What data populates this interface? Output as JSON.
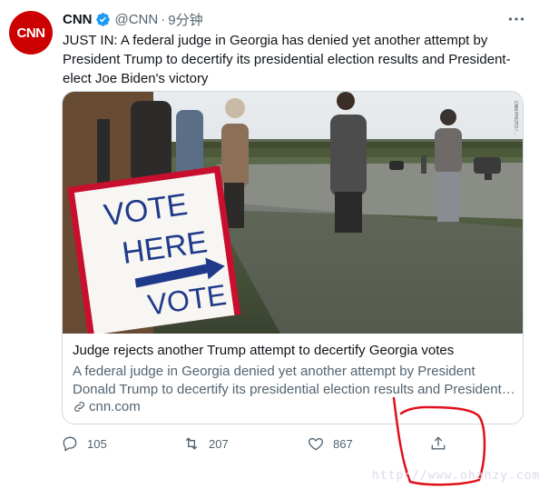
{
  "tweet": {
    "avatar_text": "CNN",
    "author_name": "CNN",
    "handle": "@CNN",
    "separator": "·",
    "time": "9分钟",
    "text": "JUST IN: A federal judge in Georgia has denied yet another attempt by President Trump to decertify its presidential election results and President-elect Joe Biden's victory"
  },
  "card": {
    "image_sign_lines": [
      "VOTE",
      "HERE",
      "VOTE"
    ],
    "image_credit": "CNN PHOTO / ...",
    "title": "Judge rejects another Trump attempt to decertify Georgia votes",
    "description_line1": "A federal judge in Georgia denied yet another attempt by President",
    "description_line2": "Donald Trump to decertify its presidential election results and President…",
    "domain": "cnn.com"
  },
  "actions": {
    "reply_count": "105",
    "retweet_count": "207",
    "like_count": "867"
  },
  "watermark": "http://www.ohanzy.com",
  "icons": {
    "verified": "verified-badge-icon",
    "more": "more-dots-icon",
    "link": "link-icon",
    "reply": "reply-icon",
    "retweet": "retweet-icon",
    "like": "heart-icon",
    "share": "share-icon"
  },
  "colors": {
    "avatar_bg": "#cc0000",
    "verified": "#1d9bf0",
    "secondary_text": "#536471",
    "annotation": "#e0101a"
  }
}
